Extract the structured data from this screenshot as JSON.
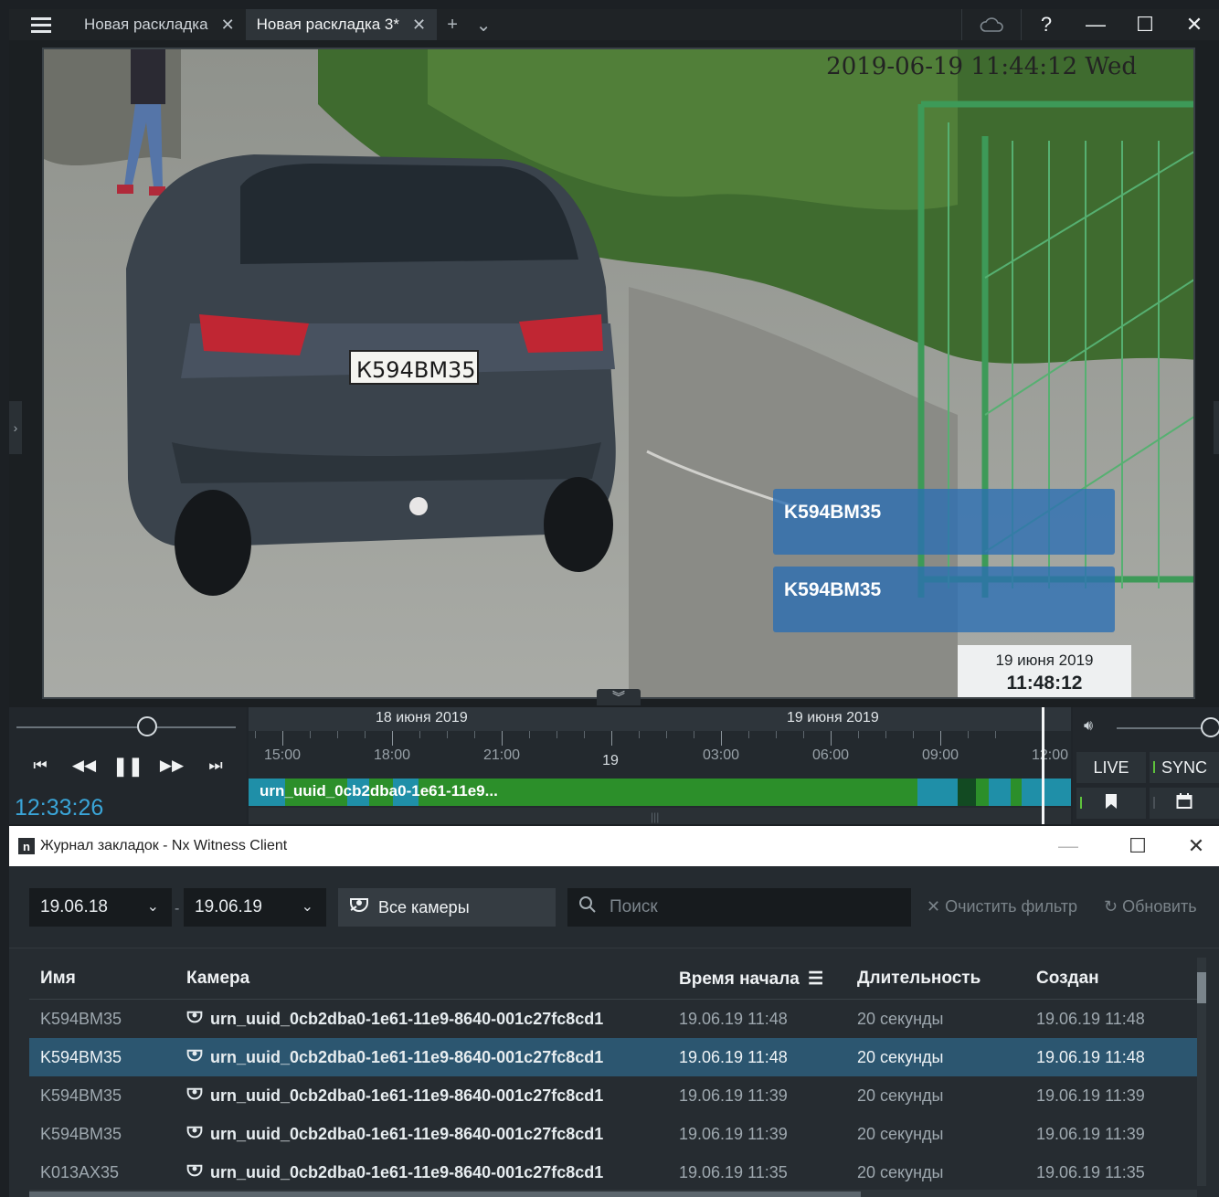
{
  "topbar": {
    "tabs": [
      {
        "label": "Новая раскладка",
        "close": "✕"
      },
      {
        "label": "Новая раскладка 3*",
        "close": "✕"
      }
    ],
    "add_tab": "+",
    "tab_menu": "⌄",
    "help": "?",
    "minimize": "—",
    "maximize": "☐",
    "close": "✕"
  },
  "video": {
    "camera_timestamp": "2019-06-19 11:44:12 Wed",
    "plate_text": "К594ВМ35",
    "plates": [
      "K594BM35",
      "K594BM35"
    ],
    "tooltip": {
      "date": "19 июня 2019",
      "time": "11:48:12"
    }
  },
  "navigation": {
    "current_time": "12:33:26",
    "speed_position": 0.58,
    "volume_position": 1.0,
    "timeline": {
      "date_headers": [
        "18 июня 2019",
        "19 июня 2019"
      ],
      "labels": [
        "15:00",
        "18:00",
        "21:00",
        "19",
        "03:00",
        "06:00",
        "09:00",
        "12:00"
      ],
      "bar_label": "urn_uuid_0cb2dba0-1e61-11e9...",
      "scroll_grip": "|||"
    },
    "buttons": {
      "live": "LIVE",
      "sync": "SYNC"
    },
    "colors": {
      "recording": "#2c8f2a",
      "motion": "#1f8fa8",
      "accent": "#3aa5d8"
    }
  },
  "bookmarks": {
    "window_title": "Журнал закладок - Nx Witness Client",
    "logo": "n",
    "filters": {
      "date_from": "19.06.18",
      "date_to": "19.06.19",
      "cameras": "Все камеры",
      "search_placeholder": "Поиск",
      "clear": "Очистить фильтр",
      "refresh": "Обновить"
    },
    "columns": [
      "Имя",
      "Камера",
      "Время начала",
      "Длительность",
      "Создан"
    ],
    "rows": [
      {
        "name": "K594BM35",
        "camera": "urn_uuid_0cb2dba0-1e61-11e9-8640-001c27fc8cd1",
        "start": "19.06.19 11:48",
        "duration": "20 секунды",
        "created": "19.06.19 11:48",
        "selected": false
      },
      {
        "name": "K594BM35",
        "camera": "urn_uuid_0cb2dba0-1e61-11e9-8640-001c27fc8cd1",
        "start": "19.06.19 11:48",
        "duration": "20 секунды",
        "created": "19.06.19 11:48",
        "selected": true
      },
      {
        "name": "K594BM35",
        "camera": "urn_uuid_0cb2dba0-1e61-11e9-8640-001c27fc8cd1",
        "start": "19.06.19 11:39",
        "duration": "20 секунды",
        "created": "19.06.19 11:39",
        "selected": false
      },
      {
        "name": "K594BM35",
        "camera": "urn_uuid_0cb2dba0-1e61-11e9-8640-001c27fc8cd1",
        "start": "19.06.19 11:39",
        "duration": "20 секунды",
        "created": "19.06.19 11:39",
        "selected": false
      },
      {
        "name": "K013AX35",
        "camera": "urn_uuid_0cb2dba0-1e61-11e9-8640-001c27fc8cd1",
        "start": "19.06.19 11:35",
        "duration": "20 секунды",
        "created": "19.06.19 11:35",
        "selected": false
      }
    ]
  }
}
